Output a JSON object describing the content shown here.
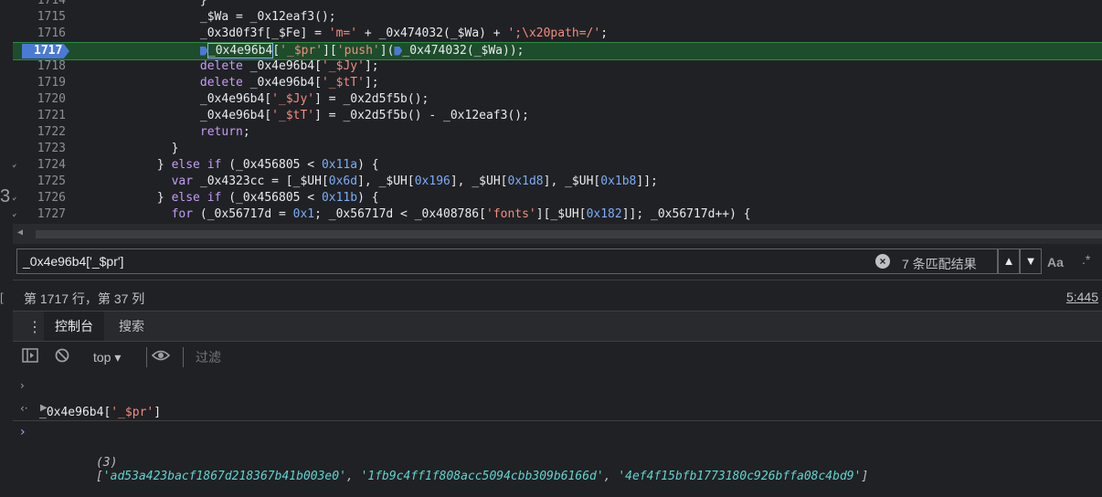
{
  "editor": {
    "lines": [
      {
        "num": "1714",
        "indent": "                  ",
        "tokens": [
          {
            "t": "}",
            "c": "var"
          }
        ]
      },
      {
        "num": "1715",
        "indent": "                  ",
        "tokens": [
          {
            "t": "_$Wa = _0x12eaf3();",
            "c": "var"
          }
        ]
      },
      {
        "num": "1716",
        "indent": "                  ",
        "tokens": [
          {
            "t": "_0x3d0f3f[_$Fe] = ",
            "c": "var"
          },
          {
            "t": "'m='",
            "c": "str"
          },
          {
            "t": " + _0x474032(_$Wa) + ",
            "c": "var"
          },
          {
            "t": "';\\x20path=/'",
            "c": "str"
          },
          {
            "t": ";",
            "c": "var"
          }
        ]
      },
      {
        "num": "1717",
        "highlight": true,
        "indent": "                  ",
        "tokens": [
          {
            "t": "_0x4e96b4",
            "c": "var"
          },
          {
            "t": "[",
            "c": "var"
          },
          {
            "t": "'_$pr'",
            "c": "str"
          },
          {
            "t": "][",
            "c": "var"
          },
          {
            "t": "'push'",
            "c": "str"
          },
          {
            "t": "](",
            "c": "var"
          },
          {
            "t": "_0x474032(_$Wa));",
            "c": "var"
          }
        ]
      },
      {
        "num": "1718",
        "indent": "                  ",
        "tokens": [
          {
            "t": "delete ",
            "c": "kw"
          },
          {
            "t": "_0x4e96b4[",
            "c": "var"
          },
          {
            "t": "'_$Jy'",
            "c": "str"
          },
          {
            "t": "];",
            "c": "var"
          }
        ]
      },
      {
        "num": "1719",
        "indent": "                  ",
        "tokens": [
          {
            "t": "delete ",
            "c": "kw"
          },
          {
            "t": "_0x4e96b4[",
            "c": "var"
          },
          {
            "t": "'_$tT'",
            "c": "str"
          },
          {
            "t": "];",
            "c": "var"
          }
        ]
      },
      {
        "num": "1720",
        "indent": "                  ",
        "tokens": [
          {
            "t": "_0x4e96b4[",
            "c": "var"
          },
          {
            "t": "'_$Jy'",
            "c": "str"
          },
          {
            "t": "] = _0x2d5f5b();",
            "c": "var"
          }
        ]
      },
      {
        "num": "1721",
        "indent": "                  ",
        "tokens": [
          {
            "t": "_0x4e96b4[",
            "c": "var"
          },
          {
            "t": "'_$tT'",
            "c": "str"
          },
          {
            "t": "] = _0x2d5f5b() - _0x12eaf3();",
            "c": "var"
          }
        ]
      },
      {
        "num": "1722",
        "indent": "                  ",
        "tokens": [
          {
            "t": "return",
            "c": "kw"
          },
          {
            "t": ";",
            "c": "var"
          }
        ]
      },
      {
        "num": "1723",
        "indent": "              ",
        "tokens": [
          {
            "t": "}",
            "c": "var"
          }
        ]
      },
      {
        "num": "1724",
        "fold": true,
        "indent": "            ",
        "tokens": [
          {
            "t": "} ",
            "c": "var"
          },
          {
            "t": "else if",
            "c": "kw"
          },
          {
            "t": " (_0x456805 < ",
            "c": "var"
          },
          {
            "t": "0x11a",
            "c": "num"
          },
          {
            "t": ") {",
            "c": "var"
          }
        ]
      },
      {
        "num": "1725",
        "indent": "              ",
        "tokens": [
          {
            "t": "var",
            "c": "kw"
          },
          {
            "t": " _0x4323cc = [_$UH[",
            "c": "var"
          },
          {
            "t": "0x6d",
            "c": "num"
          },
          {
            "t": "], _$UH[",
            "c": "var"
          },
          {
            "t": "0x196",
            "c": "num"
          },
          {
            "t": "], _$UH[",
            "c": "var"
          },
          {
            "t": "0x1d8",
            "c": "num"
          },
          {
            "t": "], _$UH[",
            "c": "var"
          },
          {
            "t": "0x1b8",
            "c": "num"
          },
          {
            "t": "]];",
            "c": "var"
          }
        ]
      },
      {
        "num": "1726",
        "fold": true,
        "indent": "            ",
        "tokens": [
          {
            "t": "} ",
            "c": "var"
          },
          {
            "t": "else if",
            "c": "kw"
          },
          {
            "t": " (_0x456805 < ",
            "c": "var"
          },
          {
            "t": "0x11b",
            "c": "num"
          },
          {
            "t": ") {",
            "c": "var"
          }
        ]
      },
      {
        "num": "1727",
        "fold": true,
        "indent": "              ",
        "tokens": [
          {
            "t": "for",
            "c": "kw"
          },
          {
            "t": " (_0x56717d = ",
            "c": "var"
          },
          {
            "t": "0x1",
            "c": "num"
          },
          {
            "t": "; _0x56717d < _0x408786[",
            "c": "var"
          },
          {
            "t": "'fonts'",
            "c": "str"
          },
          {
            "t": "][_$UH[",
            "c": "var"
          },
          {
            "t": "0x182",
            "c": "num"
          },
          {
            "t": "]]; _0x56717d++) {",
            "c": "var"
          }
        ]
      }
    ]
  },
  "left_strip": {
    "glyph": "3",
    "bracket": "["
  },
  "search": {
    "query": "_0x4e96b4['_$pr']",
    "match_count": "7 条匹配结果",
    "prev_label": "▲",
    "next_label": "▼",
    "match_case": "Aa",
    "regex": ".*"
  },
  "status": {
    "cursor": "第 1717 行，第 37 列",
    "location": "5:445"
  },
  "drawer": {
    "menu": "⋮",
    "tabs": [
      {
        "label": "控制台"
      },
      {
        "label": "搜索"
      }
    ]
  },
  "console_toolbar": {
    "context": "top ▾",
    "filter_placeholder": "过滤"
  },
  "console": {
    "input_expr": "_0x4e96b4['_$pr']",
    "result_meta": "(3)",
    "result_open": "[",
    "result_items": [
      "'ad53a423bacf1867d218367b41b003e0'",
      "'1fb9c4ff1f808acc5094cbb309b6166d'",
      "'4ef4f15bfb1773180c926bffa08c4bd9'"
    ],
    "result_close": "]"
  },
  "colors": {
    "background": "#202124",
    "highlight_line": "#1e4d2b",
    "breakpoint": "#4a7ad6",
    "string": "#f28b82",
    "keyword": "#c59cf8",
    "number": "#7cacf8",
    "result_string": "#5cd5d0"
  }
}
